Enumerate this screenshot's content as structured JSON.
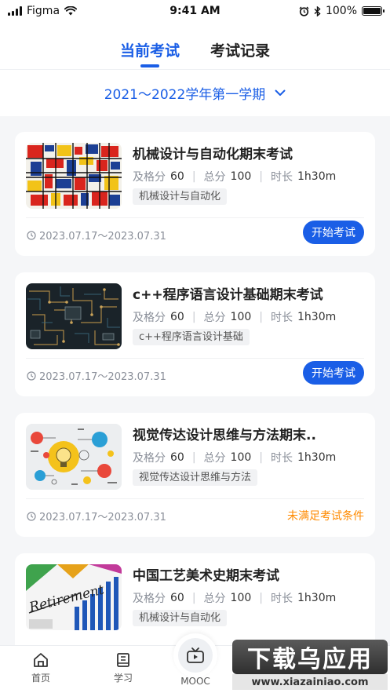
{
  "status_bar": {
    "carrier": "Figma",
    "time": "9:41 AM",
    "battery": "100%"
  },
  "tabs": [
    {
      "label": "当前考试",
      "active": true
    },
    {
      "label": "考试记录",
      "active": false
    }
  ],
  "semester": {
    "label": "2021～2022学年第一学期"
  },
  "meta_labels": {
    "pass": "及格分",
    "total": "总分",
    "duration": "时长"
  },
  "exams": [
    {
      "title": "机械设计与自动化期末考试",
      "pass": "60",
      "total": "100",
      "duration": "1h30m",
      "tag": "机械设计与自动化",
      "date": "2023.07.17～2023.07.31",
      "action": "开始考试",
      "action_type": "button"
    },
    {
      "title": "c++程序语言设计基础期末考试",
      "pass": "60",
      "total": "100",
      "duration": "1h30m",
      "tag": "c++程序语言设计基础",
      "date": "2023.07.17～2023.07.31",
      "action": "开始考试",
      "action_type": "button"
    },
    {
      "title": "视觉传达设计思维与方法期末..",
      "pass": "60",
      "total": "100",
      "duration": "1h30m",
      "tag": "视觉传达设计思维与方法",
      "date": "2023.07.17～2023.07.31",
      "action": "未满足考试条件",
      "action_type": "status"
    },
    {
      "title": "中国工艺美术史期末考试",
      "pass": "60",
      "total": "100",
      "duration": "1h30m",
      "tag": "机械设计与自动化",
      "thumb_text": "Retirement"
    }
  ],
  "tabbar": [
    {
      "label": "首页",
      "icon": "home-icon"
    },
    {
      "label": "学习",
      "icon": "book-icon"
    },
    {
      "label": "MOOC",
      "icon": "tv-icon"
    }
  ],
  "watermark": {
    "top": "下载乌应用",
    "bottom": "www.xiazainiao.com"
  },
  "colors": {
    "accent": "#1a5ee6",
    "warning": "#ff8a00",
    "background": "#f5f6f8"
  }
}
